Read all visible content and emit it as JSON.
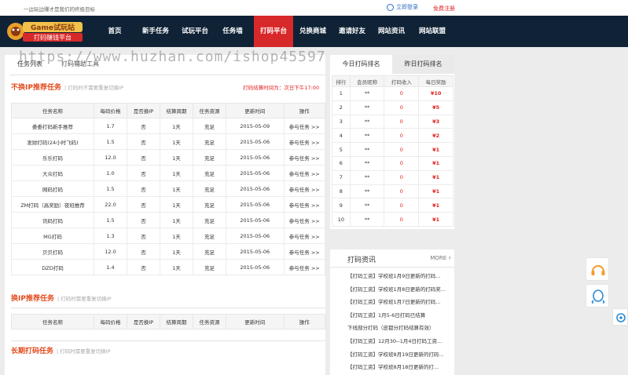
{
  "topbar": {
    "slogan": "一边玩边赚才是我们的终极目标",
    "login": "立即登录",
    "register": "免费注册"
  },
  "logo": {
    "line1": "Game试玩站",
    "line2": "打码赚钱平台"
  },
  "nav": {
    "items": [
      "首页",
      "新手任务",
      "试玩平台",
      "任务墙",
      "打码平台",
      "兑换商城",
      "邀请好友",
      "网站资讯",
      "网站联盟"
    ],
    "active_index": 4,
    "active_color": "#d8292a"
  },
  "watermark": "https://www.huzhan.com/ishop45597",
  "main": {
    "tabs": [
      "任务列表",
      "打码辅助工具"
    ],
    "section1": {
      "title": "不换IP推荐任务",
      "subtitle": "| 打码时不需要重复切换IP",
      "note": "打码结算时间为：次日下午17:00"
    },
    "columns": [
      "任务名称",
      "每码价格",
      "是否换IP",
      "结算周期",
      "任务资源",
      "更新时间",
      "操作"
    ],
    "rows": [
      [
        "委委打码新手推荐",
        "1.7",
        "否",
        "1天",
        "充足",
        "2015-05-09",
        "参与任务 >>"
      ],
      [
        "发财打码(24小时飞码)",
        "1.5",
        "否",
        "1天",
        "充足",
        "2015-05-06",
        "参与任务 >>"
      ],
      [
        "乐乐打码",
        "12.0",
        "否",
        "1天",
        "充足",
        "2015-05-06",
        "参与任务 >>"
      ],
      [
        "大众打码",
        "1.0",
        "否",
        "1天",
        "充足",
        "2015-05-06",
        "参与任务 >>"
      ],
      [
        "网码打码",
        "1.5",
        "否",
        "1天",
        "充足",
        "2015-05-06",
        "参与任务 >>"
      ],
      [
        "ZM打码（高奖励）夜班推荐",
        "22.0",
        "否",
        "1天",
        "充足",
        "2015-05-06",
        "参与任务 >>"
      ],
      [
        "讯码打码",
        "1.5",
        "否",
        "1天",
        "充足",
        "2015-05-06",
        "参与任务 >>"
      ],
      [
        "MG打码",
        "1.3",
        "否",
        "1天",
        "充足",
        "2015-05-06",
        "参与任务 >>"
      ],
      [
        "贝贝打码",
        "12.0",
        "否",
        "1天",
        "充足",
        "2015-05-06",
        "参与任务 >>"
      ],
      [
        "DZD打码",
        "1.4",
        "否",
        "1天",
        "充足",
        "2015-05-06",
        "参与任务 >>"
      ]
    ],
    "section2": {
      "title": "换IP推荐任务",
      "subtitle": "| 打码时需要重复切换IP"
    },
    "section3": {
      "title": "长期打码任务",
      "subtitle": "| 打码时需要重复切换IP"
    }
  },
  "rank": {
    "tabs": [
      "今日打码排名",
      "昨日打码排名"
    ],
    "columns": [
      "排行",
      "会员昵称",
      "打码收入",
      "每日奖励"
    ],
    "rows": [
      [
        "1",
        "**",
        "0",
        "¥10"
      ],
      [
        "2",
        "**",
        "0",
        "¥5"
      ],
      [
        "3",
        "**",
        "0",
        "¥3"
      ],
      [
        "4",
        "**",
        "0",
        "¥2"
      ],
      [
        "5",
        "**",
        "0",
        "¥1"
      ],
      [
        "6",
        "**",
        "0",
        "¥1"
      ],
      [
        "7",
        "**",
        "0",
        "¥1"
      ],
      [
        "8",
        "**",
        "0",
        "¥1"
      ],
      [
        "9",
        "**",
        "0",
        "¥1"
      ],
      [
        "10",
        "**",
        "0",
        "¥1"
      ]
    ]
  },
  "news": {
    "title": "打码资讯",
    "more": "MORE",
    "items": [
      "【打码工资】学校班1月9日更新的打码...",
      "【打码工资】学校班1月8日更新的打码奖...",
      "【打码工资】学校班1月7日更新的打码...",
      "【打码工资】1月5-6日打码已结算",
      "下线部分打码（皮都分打码结算有效）",
      "【打码工资】12月30--1月4日打码工资...",
      "【打码工资】学校班8月19日更新的打码...",
      "【打码工资】学校班8月18日更新的打..."
    ]
  },
  "side": {
    "icons": [
      "headset-icon",
      "qq-icon",
      "refresh-icon"
    ]
  }
}
